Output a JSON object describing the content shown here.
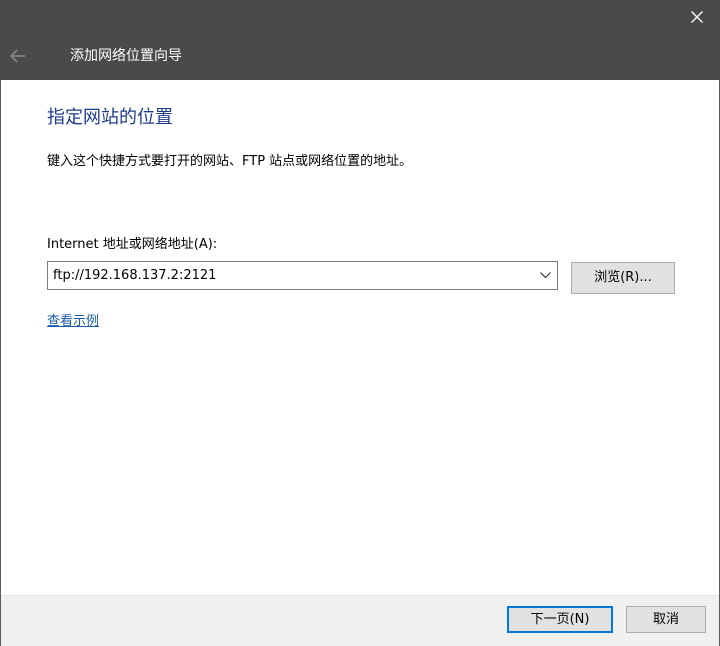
{
  "window": {
    "title": "添加网络位置向导",
    "back_icon": "arrow-left-icon",
    "close_icon": "close-icon"
  },
  "content": {
    "heading": "指定网站的位置",
    "description": "键入这个快捷方式要打开的网站、FTP 站点或网络位置的地址。",
    "address_label": "Internet 地址或网络地址(A):",
    "address_value": "ftp://192.168.137.2:2121",
    "browse_label": "浏览(R)...",
    "example_link": "查看示例"
  },
  "footer": {
    "next_label": "下一页(N)",
    "cancel_label": "取消"
  },
  "colors": {
    "titlebar": "#4a4a48",
    "heading": "#1e3c8c",
    "link": "#1a5ea8",
    "focus_border": "#0078d7"
  }
}
